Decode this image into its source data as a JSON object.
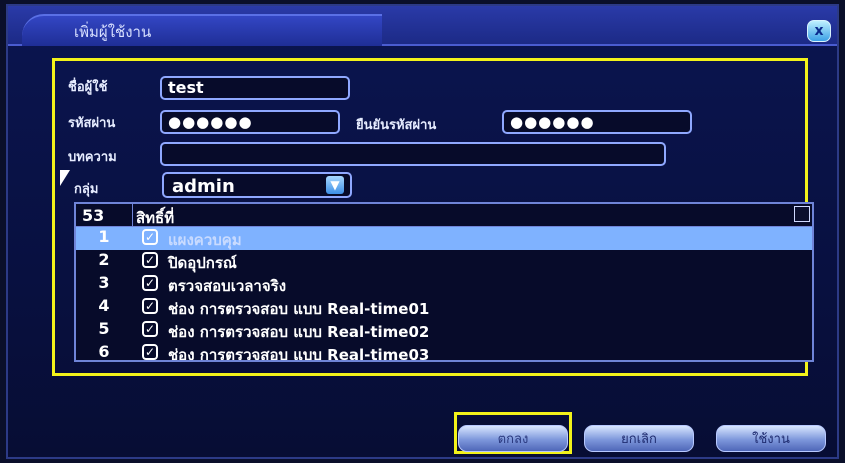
{
  "dialog": {
    "title": "เพิ่มผู้ใช้งาน",
    "close_label": "x"
  },
  "form": {
    "username_label": "ชื่อผู้ใช้",
    "username_value": "test",
    "password_label": "รหัสผ่าน",
    "password_value": "●●●●●●",
    "confirm_label": "ยืนยันรหัสผ่าน",
    "confirm_value": "●●●●●●",
    "memo_label": "บทความ",
    "memo_value": "",
    "group_label": "กลุ่ม",
    "group_value": "admin"
  },
  "permissions": {
    "count": "53",
    "header": "สิทธิ์ที่",
    "rows": [
      {
        "num": "1",
        "label": "แผงควบคุม"
      },
      {
        "num": "2",
        "label": "ปิดอุปกรณ์"
      },
      {
        "num": "3",
        "label": "ตรวจสอบเวลาจริง"
      },
      {
        "num": "4",
        "label": "ช่อง การตรวจสอบ แบบ Real-time01"
      },
      {
        "num": "5",
        "label": "ช่อง การตรวจสอบ แบบ Real-time02"
      },
      {
        "num": "6",
        "label": "ช่อง การตรวจสอบ แบบ Real-time03"
      }
    ]
  },
  "buttons": {
    "ok": "ตกลง",
    "cancel": "ยกเลิก",
    "apply": "ใช้งาน"
  }
}
